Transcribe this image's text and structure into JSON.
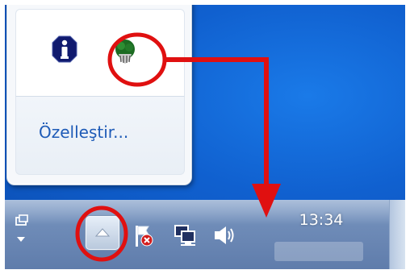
{
  "popup": {
    "customize_link": "Özelleştir..."
  },
  "taskbar": {
    "clock_time": "13:34"
  },
  "icons": {
    "info": "info-icon",
    "green_app": "green-tray-app-icon",
    "show_hidden": "up-arrow-icon",
    "action_center": "flag-with-red-x-icon",
    "network": "network-icon",
    "volume": "speaker-icon"
  },
  "colors": {
    "desktop": "#1060cf",
    "annotation": "#e01010",
    "link": "#1e5bb7"
  }
}
